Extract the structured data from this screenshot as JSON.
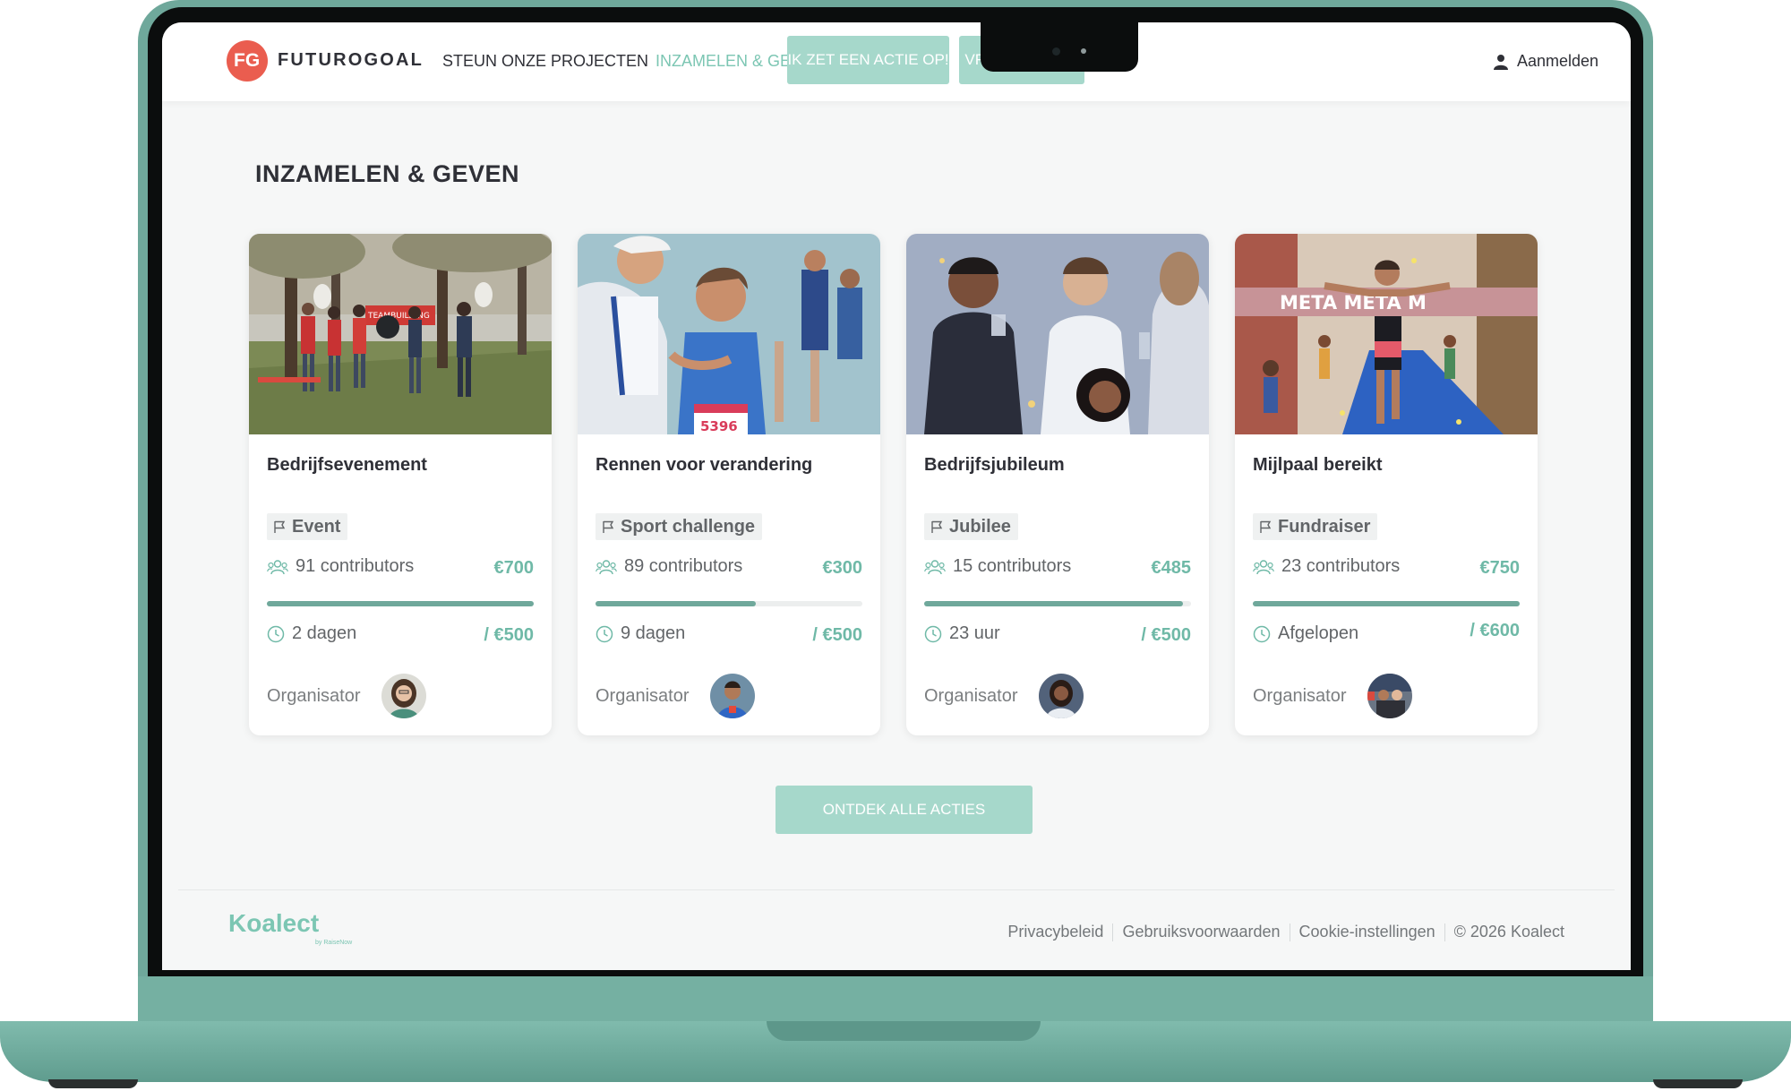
{
  "navbar": {
    "logo_initials": "FG",
    "brand": "FUTUROGOAL",
    "links": [
      "STEUN ONZE PROJECTEN",
      "INZAMELEN & GEVEN"
    ],
    "active_link": "INZAMELEN & GEVEN",
    "primary_button": "IK ZET EEN ACTIE OP!",
    "secondary_button": "VRIJE DONATIE",
    "login": "Aanmelden"
  },
  "main": {
    "title": "INZAMELEN & GEVEN",
    "cards": [
      {
        "title": "Bedrijfsevenement",
        "tag": "Event",
        "contributors": "91 contributors",
        "raised": "€700",
        "time_left": "2 dagen",
        "goal": "/ €500",
        "progress": 1.0,
        "organizer_label": "Organisator"
      },
      {
        "title": "Rennen voor verandering",
        "tag": "Sport challenge",
        "contributors": "89 contributors",
        "raised": "€300",
        "time_left": "9 dagen",
        "goal": "/ €500",
        "progress": 0.6,
        "organizer_label": "Organisator"
      },
      {
        "title": "Bedrijfsjubileum",
        "tag": "Jubilee",
        "contributors": "15 contributors",
        "raised": "€485",
        "time_left": "23 uur",
        "goal": "/ €500",
        "progress": 0.97,
        "organizer_label": "Organisator"
      },
      {
        "title": "Mijlpaal bereikt",
        "tag": "Fundraiser",
        "contributors": "23 contributors",
        "raised": "€750",
        "time_left": "Afgelopen",
        "goal": "/ €600",
        "progress": 1.0,
        "organizer_label": "Organisator"
      }
    ],
    "cta": "ONTDEK ALLE ACTIES"
  },
  "image_text": {
    "banner_1": "TEAMBUILDING",
    "bib_2": "5396",
    "finish_banner": "META META M"
  },
  "footer": {
    "logo": "Koalect",
    "logo_sub": "by RaiseNow",
    "links": [
      "Privacybeleid",
      "Gebruiksvoorwaarden",
      "Cookie-instellingen"
    ],
    "copyright": "© 2026 Koalect"
  },
  "colors": {
    "accent": "#6fb9a7",
    "button": "#a6d8cb",
    "progress": "#6fa89b",
    "logo": "#ea5d4f",
    "text": "#2f3037",
    "laptop": "#6fa89b"
  }
}
